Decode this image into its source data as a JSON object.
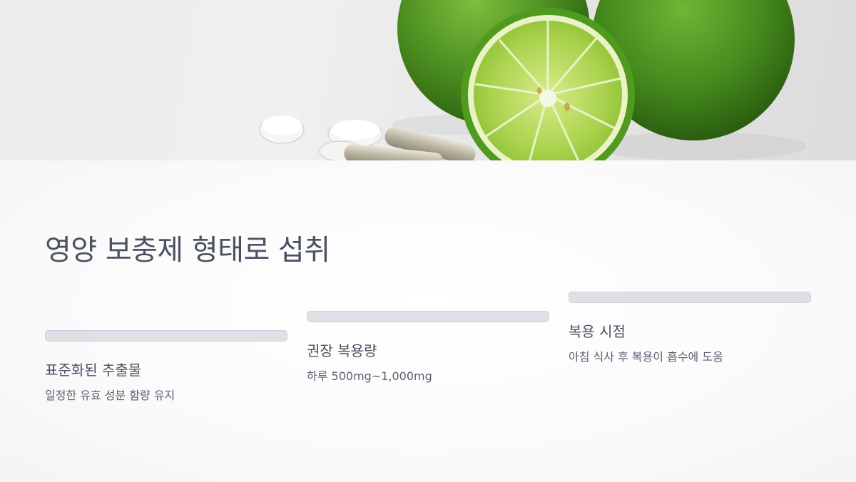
{
  "title": "영양 보충제 형태로 섭취",
  "cards": [
    {
      "label": "표준화된 추출물",
      "description": "일정한 유효 성분 함량 유지"
    },
    {
      "label": "권장 복용량",
      "description": "하루 500mg~1,000mg"
    },
    {
      "label": "복용 시점",
      "description": "아침 식사 후 복용이 흡수에 도움"
    }
  ],
  "colors": {
    "text": "#4b5160",
    "bar": "#dfe0e6",
    "lime": "#5c9e2a"
  }
}
